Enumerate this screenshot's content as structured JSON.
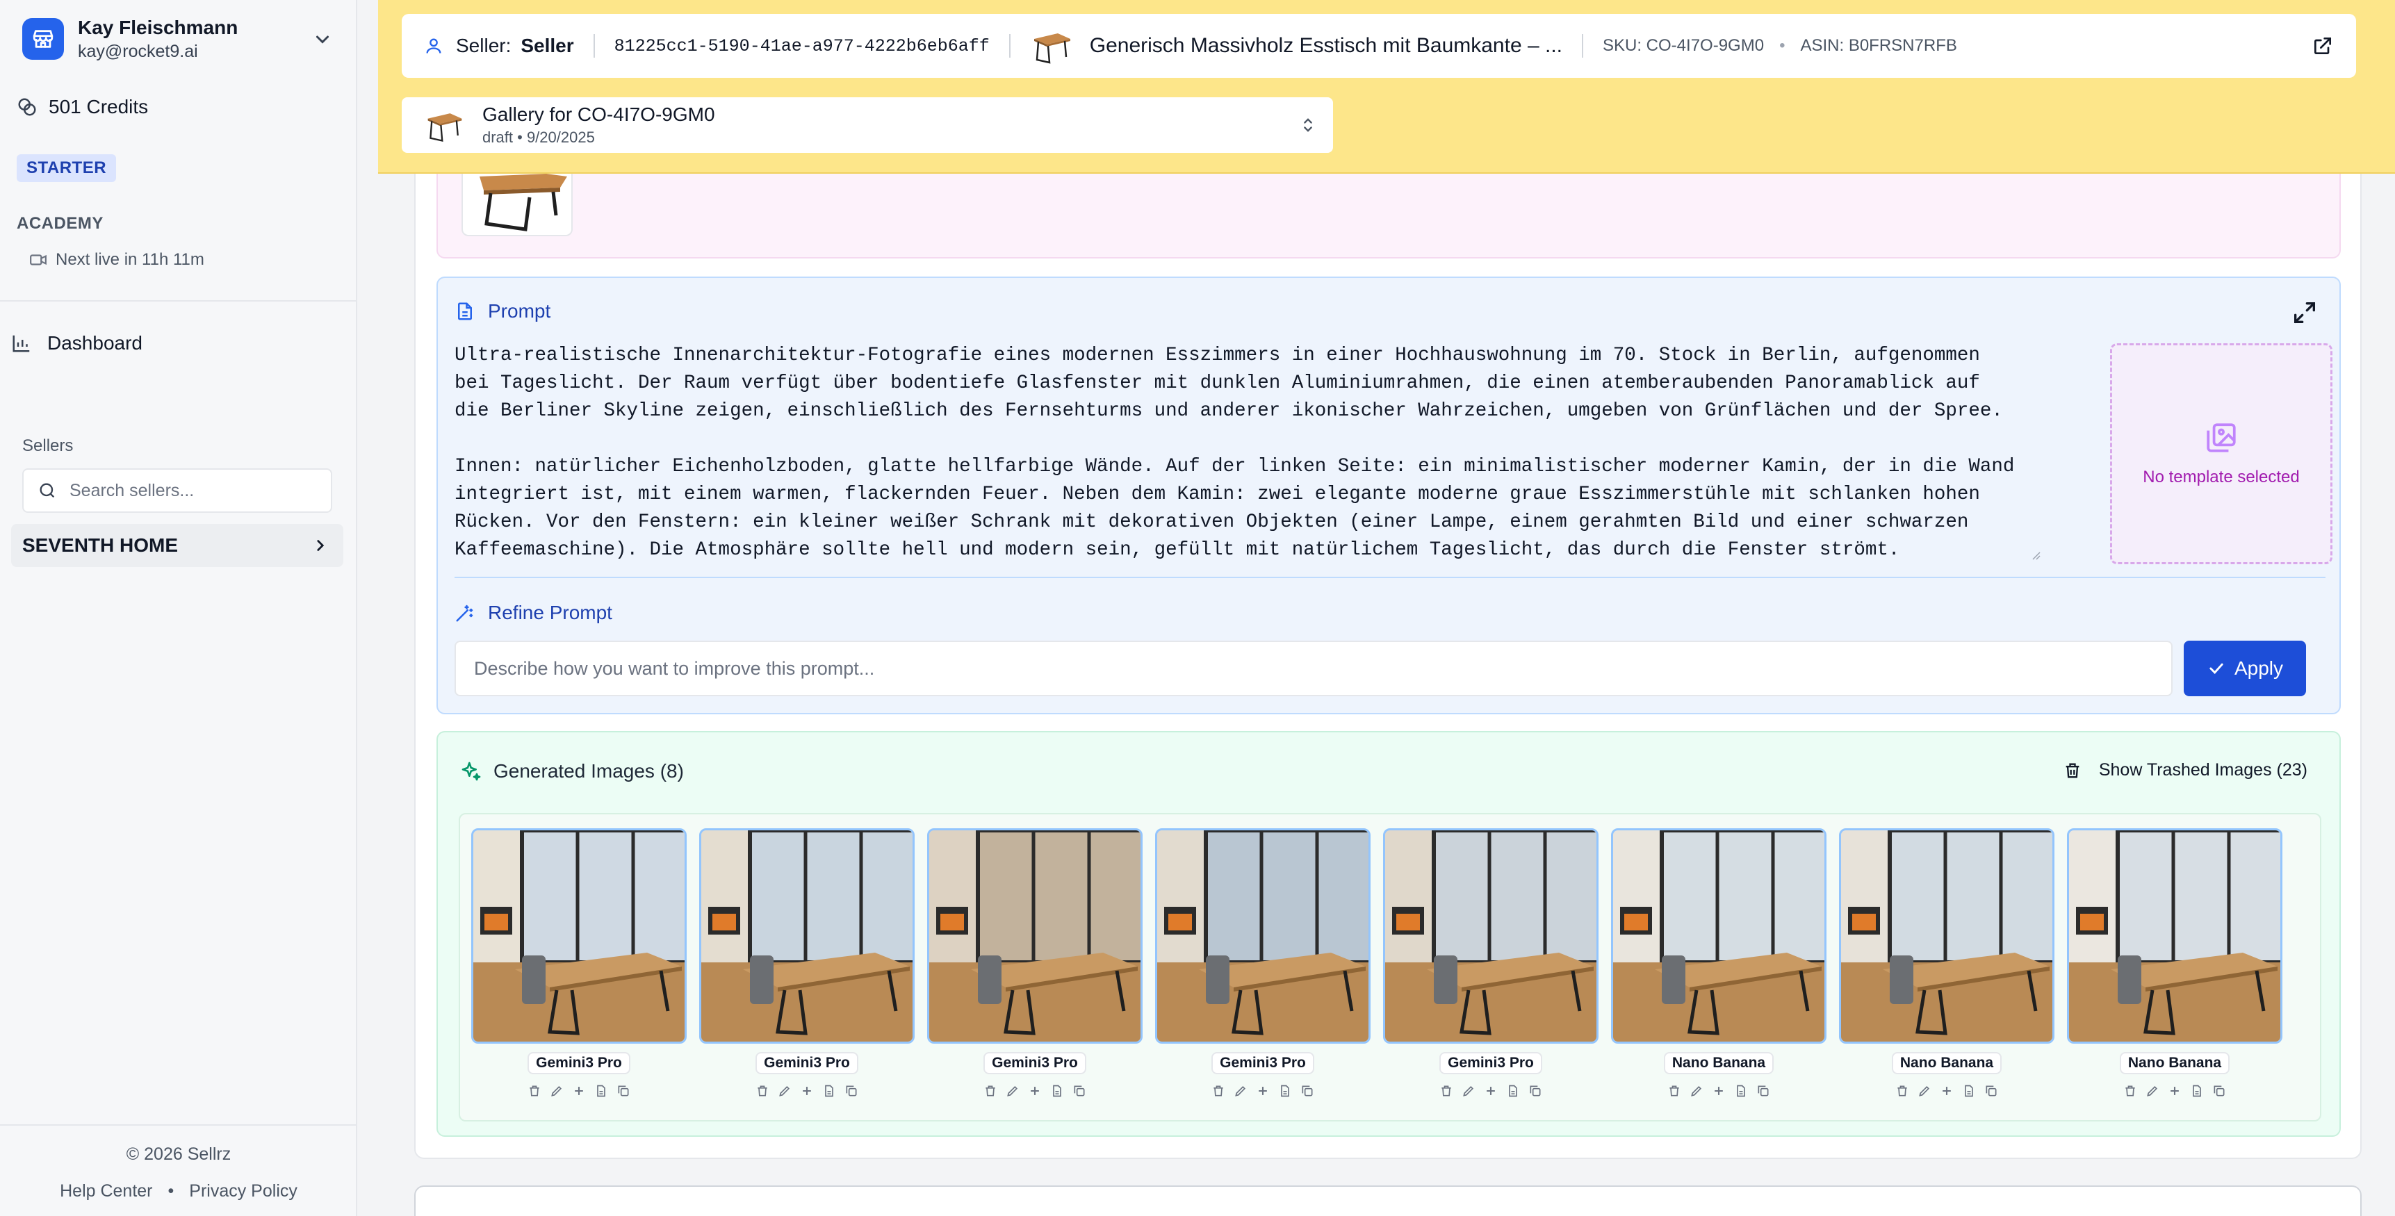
{
  "user": {
    "name": "Kay Fleischmann",
    "email": "kay@rocket9.ai"
  },
  "credits": "501 Credits",
  "plan": "STARTER",
  "academy": {
    "title": "ACADEMY",
    "next_live": "Next live in 11h 11m"
  },
  "nav": {
    "dashboard": "Dashboard"
  },
  "sellers": {
    "title": "Sellers",
    "search_placeholder": "Search sellers...",
    "items": [
      "SEVENTH HOME"
    ]
  },
  "footer": {
    "copyright": "© 2026 Sellrz",
    "help": "Help Center",
    "sep": "•",
    "privacy": "Privacy Policy"
  },
  "header": {
    "seller_label": "Seller:",
    "seller_value": "Seller",
    "seller_id": "81225cc1-5190-41ae-a977-4222b6eb6aff",
    "product_title": "Generisch Massivholz Esstisch mit Baumkante – ...",
    "sku": "SKU: CO-4I7O-9GM0",
    "dot": "•",
    "asin": "ASIN: B0FRSN7RFB"
  },
  "gallery": {
    "title": "Gallery for CO-4I7O-9GM0",
    "subtitle": "draft • 9/20/2025"
  },
  "prompt": {
    "label": "Prompt",
    "text": "Ultra-realistische Innenarchitektur-Fotografie eines modernen Esszimmers in einer Hochhauswohnung im 70. Stock in Berlin, aufgenommen\nbei Tageslicht. Der Raum verfügt über bodentiefe Glasfenster mit dunklen Aluminiumrahmen, die einen atemberaubenden Panoramablick auf\ndie Berliner Skyline zeigen, einschließlich des Fernsehturms und anderer ikonischer Wahrzeichen, umgeben von Grünflächen und der Spree.\n\nInnen: natürlicher Eichenholzboden, glatte hellfarbige Wände. Auf der linken Seite: ein minimalistischer moderner Kamin, der in die Wand\nintegriert ist, mit einem warmen, flackernden Feuer. Neben dem Kamin: zwei elegante moderne graue Esszimmerstühle mit schlanken hohen\nRücken. Vor den Fenstern: ein kleiner weißer Schrank mit dekorativen Objekten (einer Lampe, einem gerahmten Bild und einer schwarzen\nKaffeemaschine). Die Atmosphäre sollte hell und modern sein, gefüllt mit natürlichem Tageslicht, das durch die Fenster strömt.",
    "template_label": "No template selected",
    "refine_label": "Refine Prompt",
    "refine_placeholder": "Describe how you want to improve this prompt...",
    "apply_label": "Apply"
  },
  "generated": {
    "title": "Generated Images (8)",
    "trashed_label": "Show Trashed Images (23)",
    "images": [
      {
        "model": "Gemini3 Pro"
      },
      {
        "model": "Gemini3 Pro"
      },
      {
        "model": "Gemini3 Pro"
      },
      {
        "model": "Gemini3 Pro"
      },
      {
        "model": "Gemini3 Pro"
      },
      {
        "model": "Nano Banana"
      },
      {
        "model": "Nano Banana"
      },
      {
        "model": "Nano Banana"
      }
    ]
  },
  "colors": {
    "accent": "#1d4ed8",
    "header_bg": "#fde68a",
    "plan_badge": "#dbe4fe"
  }
}
